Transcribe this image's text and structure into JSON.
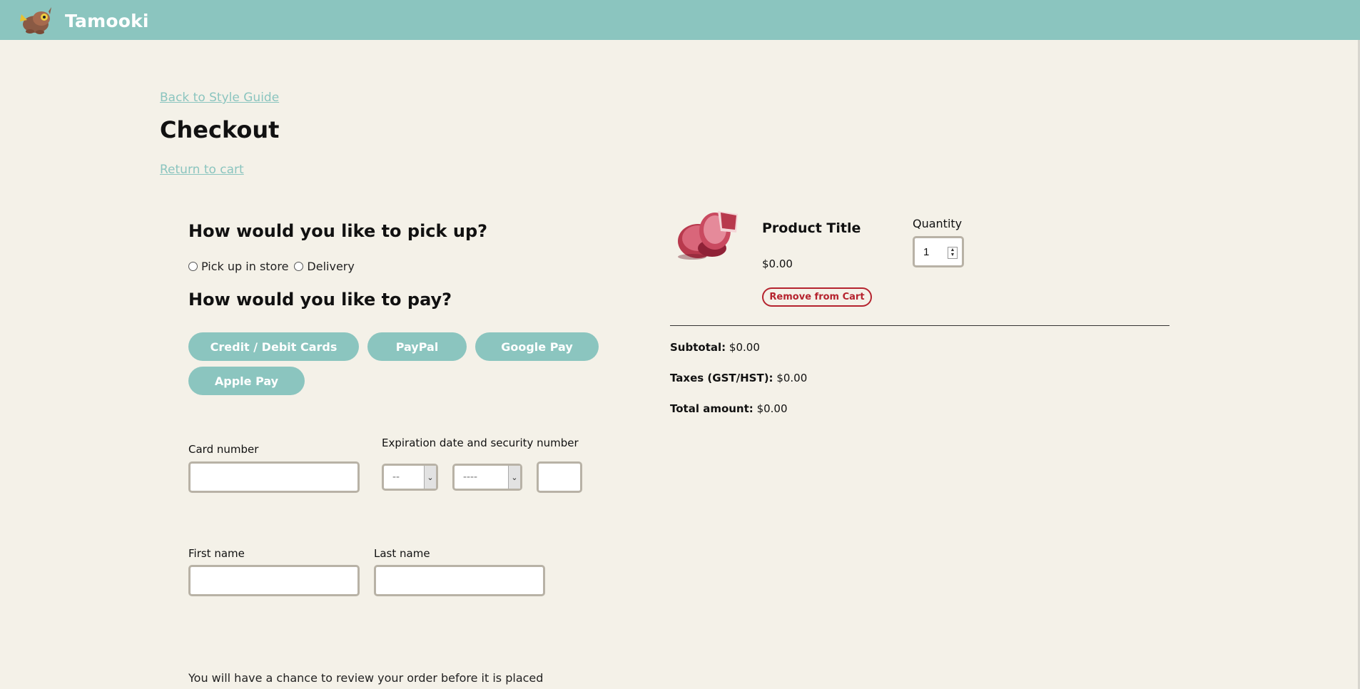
{
  "header": {
    "brand": "Tamooki"
  },
  "nav": {
    "back_link": "Back to Style Guide",
    "return_link": "Return to cart"
  },
  "page": {
    "title": "Checkout"
  },
  "pickup": {
    "heading": "How would you like to pick up?",
    "options": [
      "Pick up in store",
      "Delivery"
    ]
  },
  "payment": {
    "heading": "How would you like to pay?",
    "methods": [
      "Credit / Debit Cards",
      "PayPal",
      "Google Pay",
      "Apple Pay"
    ]
  },
  "card_form": {
    "card_number_label": "Card number",
    "expiration_label": "Expiration date and security number",
    "month_placeholder": "--",
    "year_placeholder": "----",
    "card_number_value": "",
    "cvv_value": ""
  },
  "name_form": {
    "first_name_label": "First name",
    "last_name_label": "Last name",
    "first_name_value": "",
    "last_name_value": ""
  },
  "footer_note": "You will have a chance to review your order before it is placed",
  "cart": {
    "product_title": "Product Title",
    "product_price": "$0.00",
    "remove_label": "Remove from Cart",
    "quantity_label": "Quantity",
    "quantity_value": "1"
  },
  "summary": {
    "subtotal_label": "Subtotal:",
    "subtotal_value": "$0.00",
    "taxes_label": "Taxes (GST/HST):",
    "taxes_value": "$0.00",
    "total_label": "Total amount:",
    "total_value": "$0.00"
  },
  "colors": {
    "accent": "#8bc5bf",
    "background": "#f4f1e8",
    "danger": "#b5232e",
    "input_border": "#b8b2a6"
  },
  "icons": {
    "logo": "raccoon-logo-icon",
    "product_image": "macaron-stack-image"
  }
}
